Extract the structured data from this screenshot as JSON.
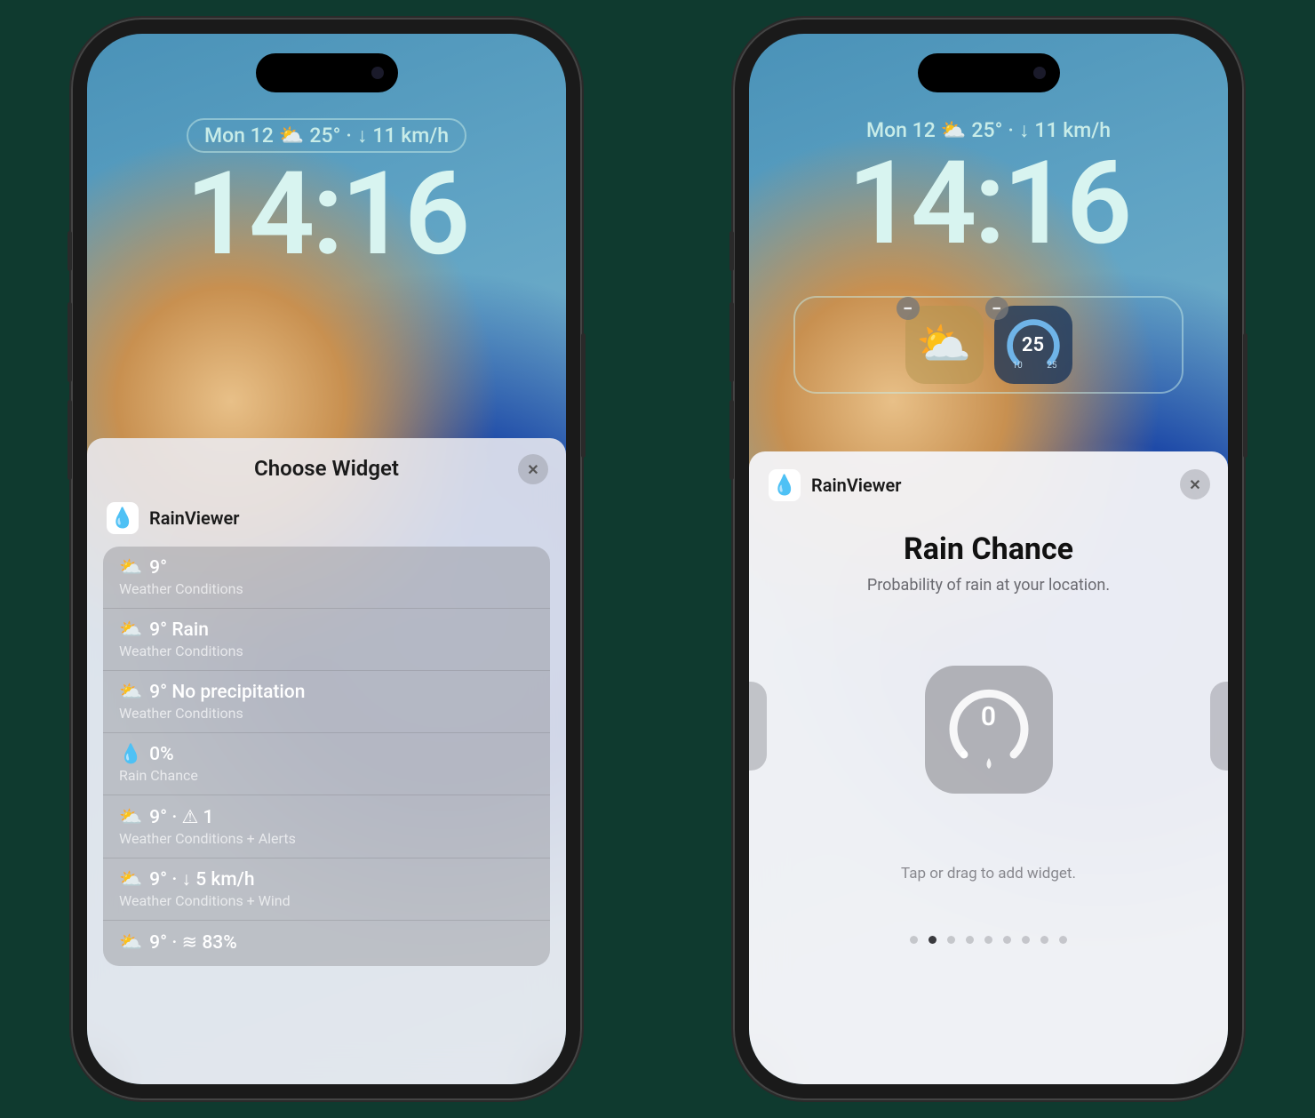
{
  "lock": {
    "date": "Mon 12",
    "weather_icon": "⛅",
    "temp": "25°",
    "wind_icon": "↓",
    "wind": "11 km/h",
    "time": "14:16"
  },
  "widgets_row": {
    "gauge_value": "25",
    "gauge_lo": "10",
    "gauge_hi": "25"
  },
  "choose_sheet": {
    "title": "Choose Widget",
    "app_name": "RainViewer",
    "items": [
      {
        "icon": "⛅",
        "line1": "9°",
        "line2": "Weather Conditions"
      },
      {
        "icon": "⛅",
        "line1": "9° Rain",
        "line2": "Weather Conditions"
      },
      {
        "icon": "⛅",
        "line1": "9° No precipitation",
        "line2": "Weather Conditions"
      },
      {
        "icon": "💧",
        "line1": "0%",
        "line2": "Rain Chance"
      },
      {
        "icon": "⛅",
        "line1": "9° · ⚠ 1",
        "line2": "Weather Conditions + Alerts"
      },
      {
        "icon": "⛅",
        "line1": "9° · ↓ 5 km/h",
        "line2": "Weather Conditions + Wind"
      },
      {
        "icon": "⛅",
        "line1": "9° · ≋ 83%",
        "line2": ""
      }
    ]
  },
  "detail_sheet": {
    "app_name": "RainViewer",
    "title": "Rain Chance",
    "subtitle": "Probability of rain at your location.",
    "preview_value": "0",
    "hint": "Tap or drag to add widget.",
    "page_count": 9,
    "active_page": 1
  }
}
